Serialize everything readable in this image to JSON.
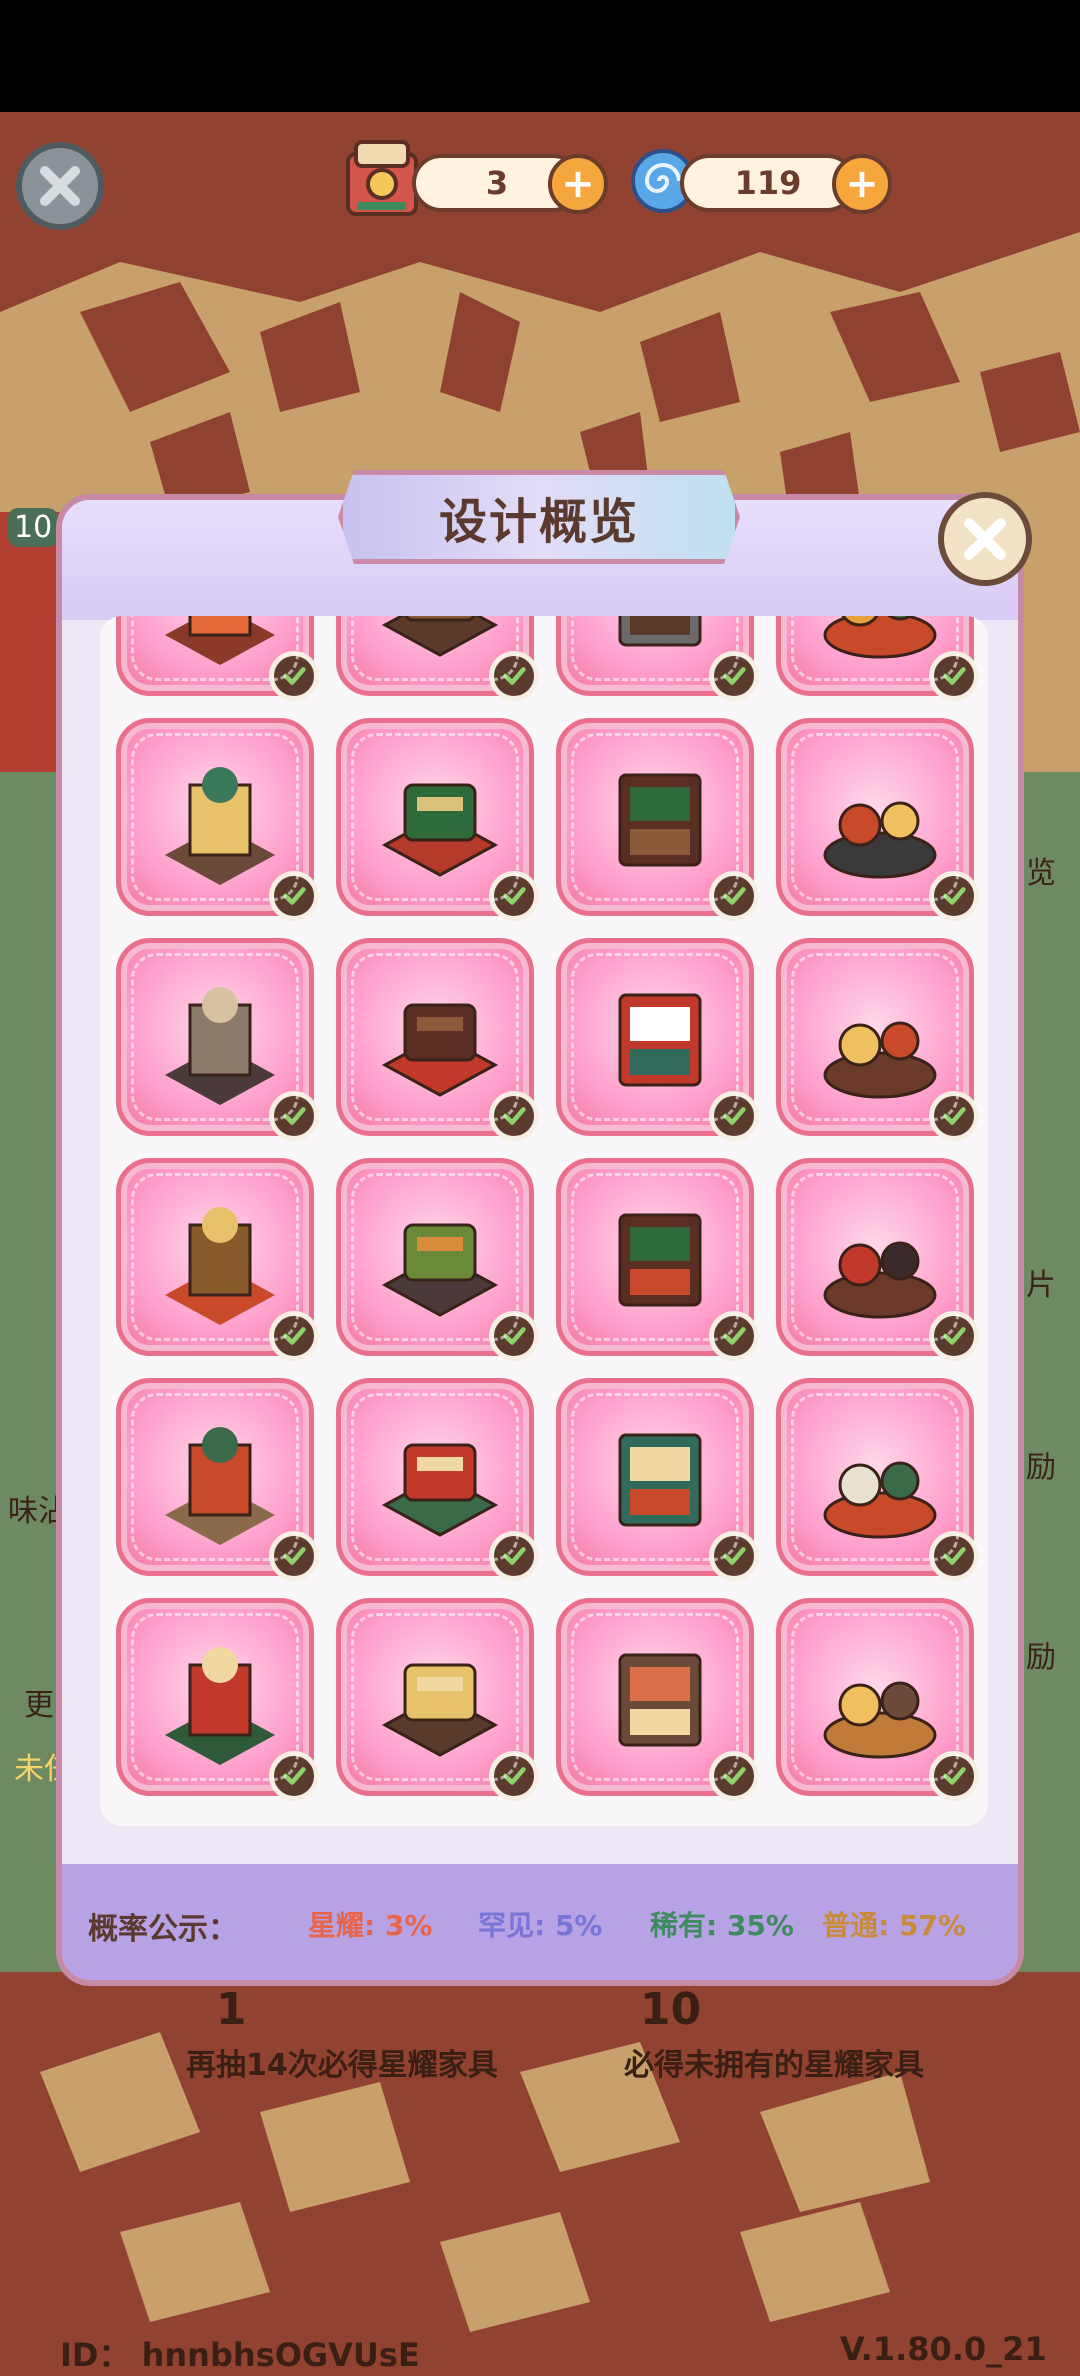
{
  "currencies": {
    "tickets": {
      "value": "3",
      "icon": "ticket-machine-icon"
    },
    "gems": {
      "value": "119",
      "icon": "swirl-orb-icon"
    }
  },
  "modal": {
    "title": "设计概览"
  },
  "items": [
    "red-flower-basket",
    "wooden-post",
    "sink-counter",
    "fruit-basket",
    "signpost",
    "red-green-booth-sofa",
    "brown-booth-sofa",
    "street-lamp",
    "display-cabinet",
    "red-bar-stool",
    "striped-food-stall",
    "lantern-snack-counter",
    "flower-vase",
    "food-display-counter",
    "lantern-cart",
    "arched-window",
    "poster-wall",
    "shop-front-red",
    "shop-front-green",
    "lion-dance-head",
    "cutting-board-set",
    "dim-sum-tray",
    "seafood-platter",
    "drinks-snack-set"
  ],
  "rates": {
    "label": "概率公示：",
    "items": [
      {
        "text": "星耀: 3%",
        "color": "#e8654a"
      },
      {
        "text": "罕见: 5%",
        "color": "#7a74d8"
      },
      {
        "text": "稀有: 35%",
        "color": "#3f8a5f"
      },
      {
        "text": "普通: 57%",
        "color": "#c98a3a"
      }
    ]
  },
  "background": {
    "left_caption": "再抽14次必得星耀家具",
    "right_caption": "必得未拥有的星耀家具",
    "left_num": "1",
    "right_num": "10",
    "left_side_badge": "10",
    "left_labels": [
      "味沾",
      "更",
      "未任"
    ],
    "right_labels": [
      "览",
      "片",
      "励",
      "励"
    ]
  },
  "footer_meta": {
    "id": "ID：  hnnbhsOGVUsE",
    "version": "V.1.80.0_21"
  },
  "colors": {
    "accent_brown": "#6b3b2c",
    "tile_pink": "#ff9fcc",
    "footer_purple": "#b6a2e4"
  }
}
